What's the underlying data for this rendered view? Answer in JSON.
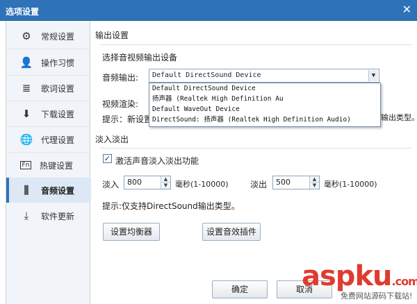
{
  "window": {
    "title": "选项设置",
    "close_glyph": "✕"
  },
  "sidebar": {
    "items": [
      {
        "label": "常规设置",
        "icon": "gear-icon",
        "glyph": "⚙"
      },
      {
        "label": "操作习惯",
        "icon": "person-icon",
        "glyph": "👤"
      },
      {
        "label": "歌词设置",
        "icon": "lyrics-icon",
        "glyph": "≣"
      },
      {
        "label": "下载设置",
        "icon": "download-icon",
        "glyph": "⬇"
      },
      {
        "label": "代理设置",
        "icon": "globe-icon",
        "glyph": "🌐"
      },
      {
        "label": "热键设置",
        "icon": "hotkey-icon",
        "glyph": "Fn"
      },
      {
        "label": "音频设置",
        "icon": "equalizer-icon",
        "glyph": "⫼",
        "active": true
      },
      {
        "label": "软件更新",
        "icon": "update-icon",
        "glyph": "⤓"
      }
    ]
  },
  "output": {
    "section_title": "输出设置",
    "device_prompt": "选择音视频输出设备",
    "audio_label": "音频输出:",
    "audio_selected": "Default DirectSound Device",
    "video_label": "视频渲染:",
    "hint_prefix": "提示：新设置",
    "hint_suffix": "输出类型。",
    "options": [
      "Default DirectSound Device",
      "扬声器 (Realtek High Definition Au",
      "Default WaveOut Device",
      "DirectSound: 扬声器 (Realtek High Definition Audio)"
    ]
  },
  "fade": {
    "section_title": "淡入淡出",
    "checkbox_label": "激活声音淡入淡出功能",
    "checkbox_checked": true,
    "fade_in_label": "淡入",
    "fade_in_value": "800",
    "fade_in_unit": "毫秒(1-10000)",
    "fade_out_label": "淡出",
    "fade_out_value": "500",
    "fade_out_unit": "毫秒(1-10000)",
    "hint": "提示:仅支持DirectSound输出类型。"
  },
  "buttons": {
    "equalizer": "设置均衡器",
    "effects": "设置音效插件",
    "ok": "确定",
    "cancel": "取消"
  },
  "watermark": {
    "brand_a": "asp",
    "brand_b": "ku",
    "brand_c": ".com",
    "sub": "免费网站源码下载站!"
  }
}
